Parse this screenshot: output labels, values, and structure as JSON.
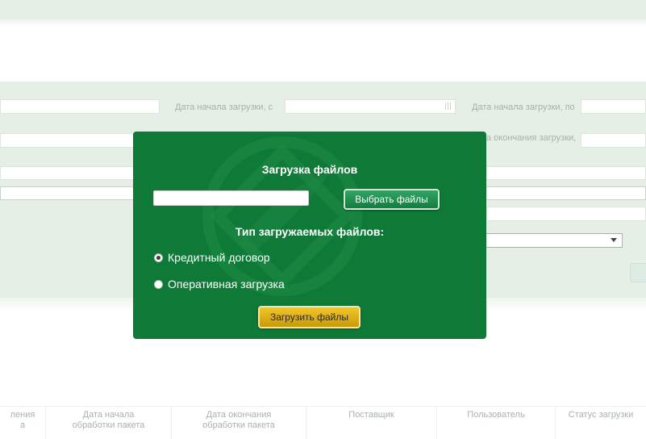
{
  "filters": {
    "date_start_from_label": "Дата начала загрузки, с",
    "date_start_to_label": "Дата начала загрузки, по",
    "date_end_label_partial": "а окончания загрузки,"
  },
  "table": {
    "columns": [
      "ления\nа",
      "Дата начала\nобработки пакета",
      "Дата окончания\nобработки пакета",
      "Поставщик",
      "Пользователь",
      "Статус загрузки"
    ]
  },
  "modal": {
    "title": "Загрузка файлов",
    "file_input_value": "",
    "choose_button": "Выбрать файлы",
    "type_title": "Тип загружаемых файлов:",
    "options": [
      {
        "label": "Кредитный договор",
        "checked": true
      },
      {
        "label": "Оперативная загрузка",
        "checked": false
      }
    ],
    "upload_button": "Загрузить файлы"
  },
  "icons": {
    "calendar": "calendar-icon",
    "dropdown": "chevron-down-icon",
    "emblem": "bank-emblem-icon"
  },
  "colors": {
    "modal_bg": "#0f7a37",
    "choose_btn": "#1f8a4b",
    "upload_btn": "#e0b314",
    "panel_bg": "#e6efe6"
  }
}
